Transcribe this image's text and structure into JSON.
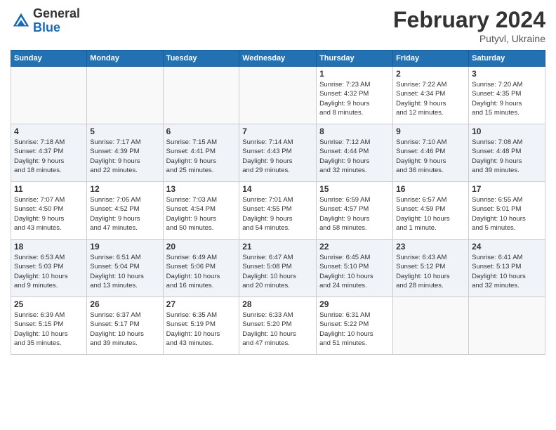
{
  "logo": {
    "general": "General",
    "blue": "Blue"
  },
  "title": {
    "month_year": "February 2024",
    "location": "Putyvl, Ukraine"
  },
  "headers": [
    "Sunday",
    "Monday",
    "Tuesday",
    "Wednesday",
    "Thursday",
    "Friday",
    "Saturday"
  ],
  "weeks": [
    [
      {
        "day": "",
        "info": ""
      },
      {
        "day": "",
        "info": ""
      },
      {
        "day": "",
        "info": ""
      },
      {
        "day": "",
        "info": ""
      },
      {
        "day": "1",
        "info": "Sunrise: 7:23 AM\nSunset: 4:32 PM\nDaylight: 9 hours\nand 8 minutes."
      },
      {
        "day": "2",
        "info": "Sunrise: 7:22 AM\nSunset: 4:34 PM\nDaylight: 9 hours\nand 12 minutes."
      },
      {
        "day": "3",
        "info": "Sunrise: 7:20 AM\nSunset: 4:35 PM\nDaylight: 9 hours\nand 15 minutes."
      }
    ],
    [
      {
        "day": "4",
        "info": "Sunrise: 7:18 AM\nSunset: 4:37 PM\nDaylight: 9 hours\nand 18 minutes."
      },
      {
        "day": "5",
        "info": "Sunrise: 7:17 AM\nSunset: 4:39 PM\nDaylight: 9 hours\nand 22 minutes."
      },
      {
        "day": "6",
        "info": "Sunrise: 7:15 AM\nSunset: 4:41 PM\nDaylight: 9 hours\nand 25 minutes."
      },
      {
        "day": "7",
        "info": "Sunrise: 7:14 AM\nSunset: 4:43 PM\nDaylight: 9 hours\nand 29 minutes."
      },
      {
        "day": "8",
        "info": "Sunrise: 7:12 AM\nSunset: 4:44 PM\nDaylight: 9 hours\nand 32 minutes."
      },
      {
        "day": "9",
        "info": "Sunrise: 7:10 AM\nSunset: 4:46 PM\nDaylight: 9 hours\nand 36 minutes."
      },
      {
        "day": "10",
        "info": "Sunrise: 7:08 AM\nSunset: 4:48 PM\nDaylight: 9 hours\nand 39 minutes."
      }
    ],
    [
      {
        "day": "11",
        "info": "Sunrise: 7:07 AM\nSunset: 4:50 PM\nDaylight: 9 hours\nand 43 minutes."
      },
      {
        "day": "12",
        "info": "Sunrise: 7:05 AM\nSunset: 4:52 PM\nDaylight: 9 hours\nand 47 minutes."
      },
      {
        "day": "13",
        "info": "Sunrise: 7:03 AM\nSunset: 4:54 PM\nDaylight: 9 hours\nand 50 minutes."
      },
      {
        "day": "14",
        "info": "Sunrise: 7:01 AM\nSunset: 4:55 PM\nDaylight: 9 hours\nand 54 minutes."
      },
      {
        "day": "15",
        "info": "Sunrise: 6:59 AM\nSunset: 4:57 PM\nDaylight: 9 hours\nand 58 minutes."
      },
      {
        "day": "16",
        "info": "Sunrise: 6:57 AM\nSunset: 4:59 PM\nDaylight: 10 hours\nand 1 minute."
      },
      {
        "day": "17",
        "info": "Sunrise: 6:55 AM\nSunset: 5:01 PM\nDaylight: 10 hours\nand 5 minutes."
      }
    ],
    [
      {
        "day": "18",
        "info": "Sunrise: 6:53 AM\nSunset: 5:03 PM\nDaylight: 10 hours\nand 9 minutes."
      },
      {
        "day": "19",
        "info": "Sunrise: 6:51 AM\nSunset: 5:04 PM\nDaylight: 10 hours\nand 13 minutes."
      },
      {
        "day": "20",
        "info": "Sunrise: 6:49 AM\nSunset: 5:06 PM\nDaylight: 10 hours\nand 16 minutes."
      },
      {
        "day": "21",
        "info": "Sunrise: 6:47 AM\nSunset: 5:08 PM\nDaylight: 10 hours\nand 20 minutes."
      },
      {
        "day": "22",
        "info": "Sunrise: 6:45 AM\nSunset: 5:10 PM\nDaylight: 10 hours\nand 24 minutes."
      },
      {
        "day": "23",
        "info": "Sunrise: 6:43 AM\nSunset: 5:12 PM\nDaylight: 10 hours\nand 28 minutes."
      },
      {
        "day": "24",
        "info": "Sunrise: 6:41 AM\nSunset: 5:13 PM\nDaylight: 10 hours\nand 32 minutes."
      }
    ],
    [
      {
        "day": "25",
        "info": "Sunrise: 6:39 AM\nSunset: 5:15 PM\nDaylight: 10 hours\nand 35 minutes."
      },
      {
        "day": "26",
        "info": "Sunrise: 6:37 AM\nSunset: 5:17 PM\nDaylight: 10 hours\nand 39 minutes."
      },
      {
        "day": "27",
        "info": "Sunrise: 6:35 AM\nSunset: 5:19 PM\nDaylight: 10 hours\nand 43 minutes."
      },
      {
        "day": "28",
        "info": "Sunrise: 6:33 AM\nSunset: 5:20 PM\nDaylight: 10 hours\nand 47 minutes."
      },
      {
        "day": "29",
        "info": "Sunrise: 6:31 AM\nSunset: 5:22 PM\nDaylight: 10 hours\nand 51 minutes."
      },
      {
        "day": "",
        "info": ""
      },
      {
        "day": "",
        "info": ""
      }
    ]
  ]
}
